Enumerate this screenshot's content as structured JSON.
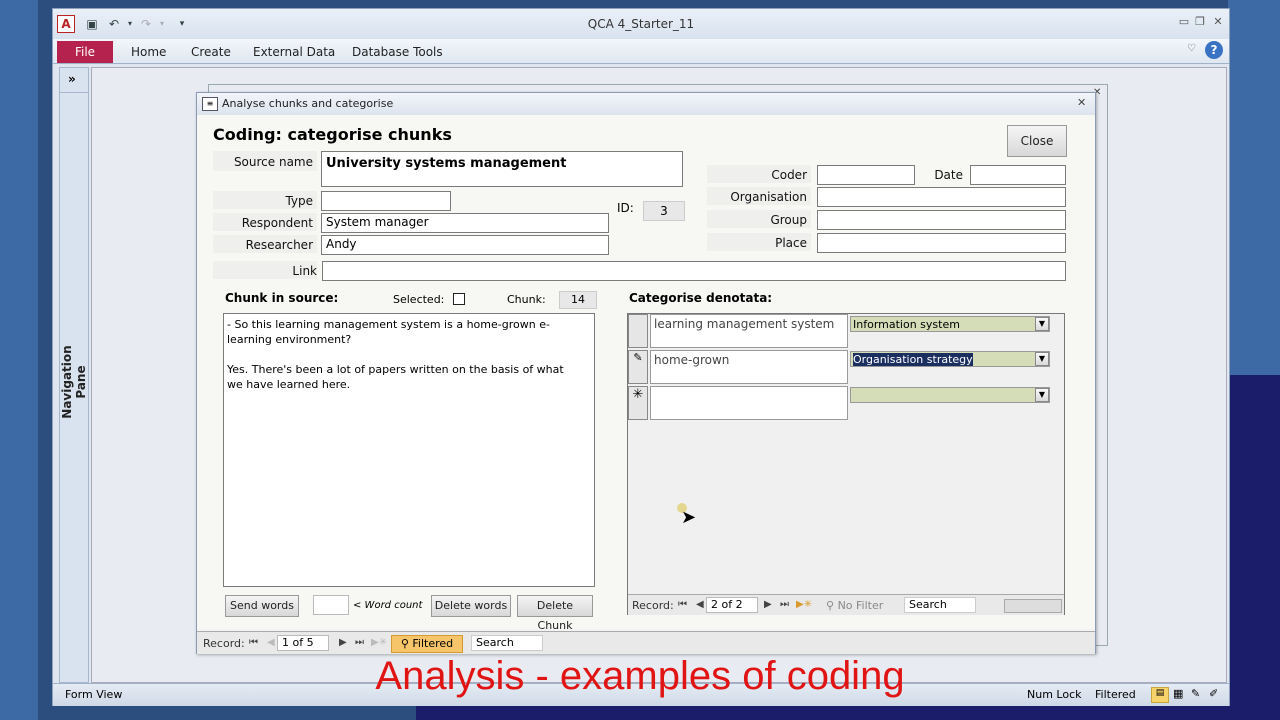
{
  "app": {
    "title": "QCA 4_Starter_11",
    "access_icon": "A",
    "ribbon_tabs": [
      "File",
      "Home",
      "Create",
      "External Data",
      "Database Tools"
    ],
    "nav_pane_label": "Navigation Pane",
    "nav_toggle": "»",
    "status": {
      "view": "Form View",
      "numlock": "Num Lock",
      "filtered": "Filtered"
    }
  },
  "form": {
    "window_title": "Analyse chunks and categorise",
    "heading": "Coding:  categorise chunks",
    "close_label": "Close",
    "labels": {
      "source_name": "Source name",
      "type": "Type",
      "respondent": "Respondent",
      "researcher": "Researcher",
      "link": "Link",
      "id": "ID:",
      "coder": "Coder",
      "date": "Date",
      "organisation": "Organisation",
      "group": "Group",
      "place": "Place"
    },
    "values": {
      "source_name": "University systems management",
      "type": "",
      "respondent": "System manager",
      "researcher": "Andy",
      "link": "",
      "id": "3",
      "coder": "",
      "date": "",
      "organisation": "",
      "group": "",
      "place": ""
    },
    "chunk": {
      "heading": "Chunk in source:",
      "selected_label": "Selected:",
      "chunk_label": "Chunk:",
      "chunk_value": "14",
      "text_line1": "- So this learning management system is a home-grown e-",
      "text_line2": "learning environment?",
      "text_line3": "Yes.  There's been a lot of papers written on the basis of what",
      "text_line4": "we have learned here.",
      "send_words": "Send words",
      "word_count_label": "< Word count",
      "delete_words": "Delete words",
      "delete_chunk": "Delete Chunk"
    },
    "categorise": {
      "heading": "Categorise denotata:",
      "rows": [
        {
          "text": "learning management system",
          "category": "Information system"
        },
        {
          "text": "home-grown",
          "category": "Organisation strategy"
        },
        {
          "text": "",
          "category": ""
        }
      ],
      "record_label": "Record:",
      "record_value": "2 of 2",
      "no_filter": "No Filter",
      "search": "Search"
    },
    "main_record": {
      "record_label": "Record:",
      "record_value": "1 of 5",
      "filtered": "Filtered",
      "search": "Search"
    }
  },
  "caption": "Analysis - examples of coding",
  "colors": {
    "file_tab": "#b4224d",
    "caption": "#e11414",
    "combo": "#d5dcb8"
  }
}
